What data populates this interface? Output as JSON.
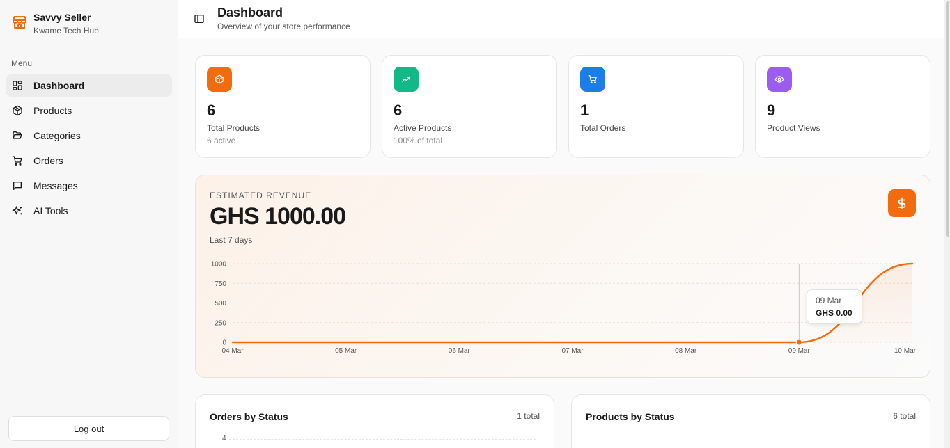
{
  "brand": {
    "name": "Savvy Seller",
    "subtitle": "Kwame Tech Hub",
    "icon": "store-icon",
    "color": "#f26b0f"
  },
  "sidebar": {
    "menu_label": "Menu",
    "items": [
      {
        "label": "Dashboard",
        "icon": "dashboard-icon",
        "active": true
      },
      {
        "label": "Products",
        "icon": "package-icon"
      },
      {
        "label": "Categories",
        "icon": "folder-icon"
      },
      {
        "label": "Orders",
        "icon": "cart-icon"
      },
      {
        "label": "Messages",
        "icon": "message-icon"
      },
      {
        "label": "AI Tools",
        "icon": "sparkles-icon"
      }
    ],
    "logout_label": "Log out"
  },
  "header": {
    "title": "Dashboard",
    "subtitle": "Overview of your store performance",
    "toggle_icon": "sidebar-toggle-icon"
  },
  "stats": [
    {
      "value": "6",
      "label": "Total Products",
      "sub": "6 active",
      "icon": "package-icon",
      "color": "#f26b0f"
    },
    {
      "value": "6",
      "label": "Active Products",
      "sub": "100% of total",
      "icon": "trending-up-icon",
      "color": "#12b886"
    },
    {
      "value": "1",
      "label": "Total Orders",
      "sub": "",
      "icon": "cart-icon",
      "color": "#1c7ce8"
    },
    {
      "value": "9",
      "label": "Product Views",
      "sub": "",
      "icon": "eye-icon",
      "color": "#9b5cf0"
    }
  ],
  "revenue": {
    "label": "ESTIMATED REVENUE",
    "value": "GHS 1000.00",
    "period": "Last 7 days",
    "icon": "dollar-icon",
    "accent": "#f26b0f",
    "tooltip": {
      "date": "09 Mar",
      "value": "GHS 0.00"
    }
  },
  "chart_data": {
    "type": "area",
    "x": [
      "04 Mar",
      "05 Mar",
      "06 Mar",
      "07 Mar",
      "08 Mar",
      "09 Mar",
      "10 Mar"
    ],
    "series": [
      {
        "values": [
          0,
          0,
          0,
          0,
          0,
          0,
          1000
        ]
      }
    ],
    "yticks": [
      0,
      250,
      500,
      750,
      1000
    ],
    "ylim": [
      0,
      1000
    ],
    "grid": true,
    "color": "#f26b0f",
    "highlight_index": 5
  },
  "orders_by_status": {
    "title": "Orders by Status",
    "total": "1 total",
    "y_top_tick": "4"
  },
  "products_by_status": {
    "title": "Products by Status",
    "total": "6 total"
  }
}
